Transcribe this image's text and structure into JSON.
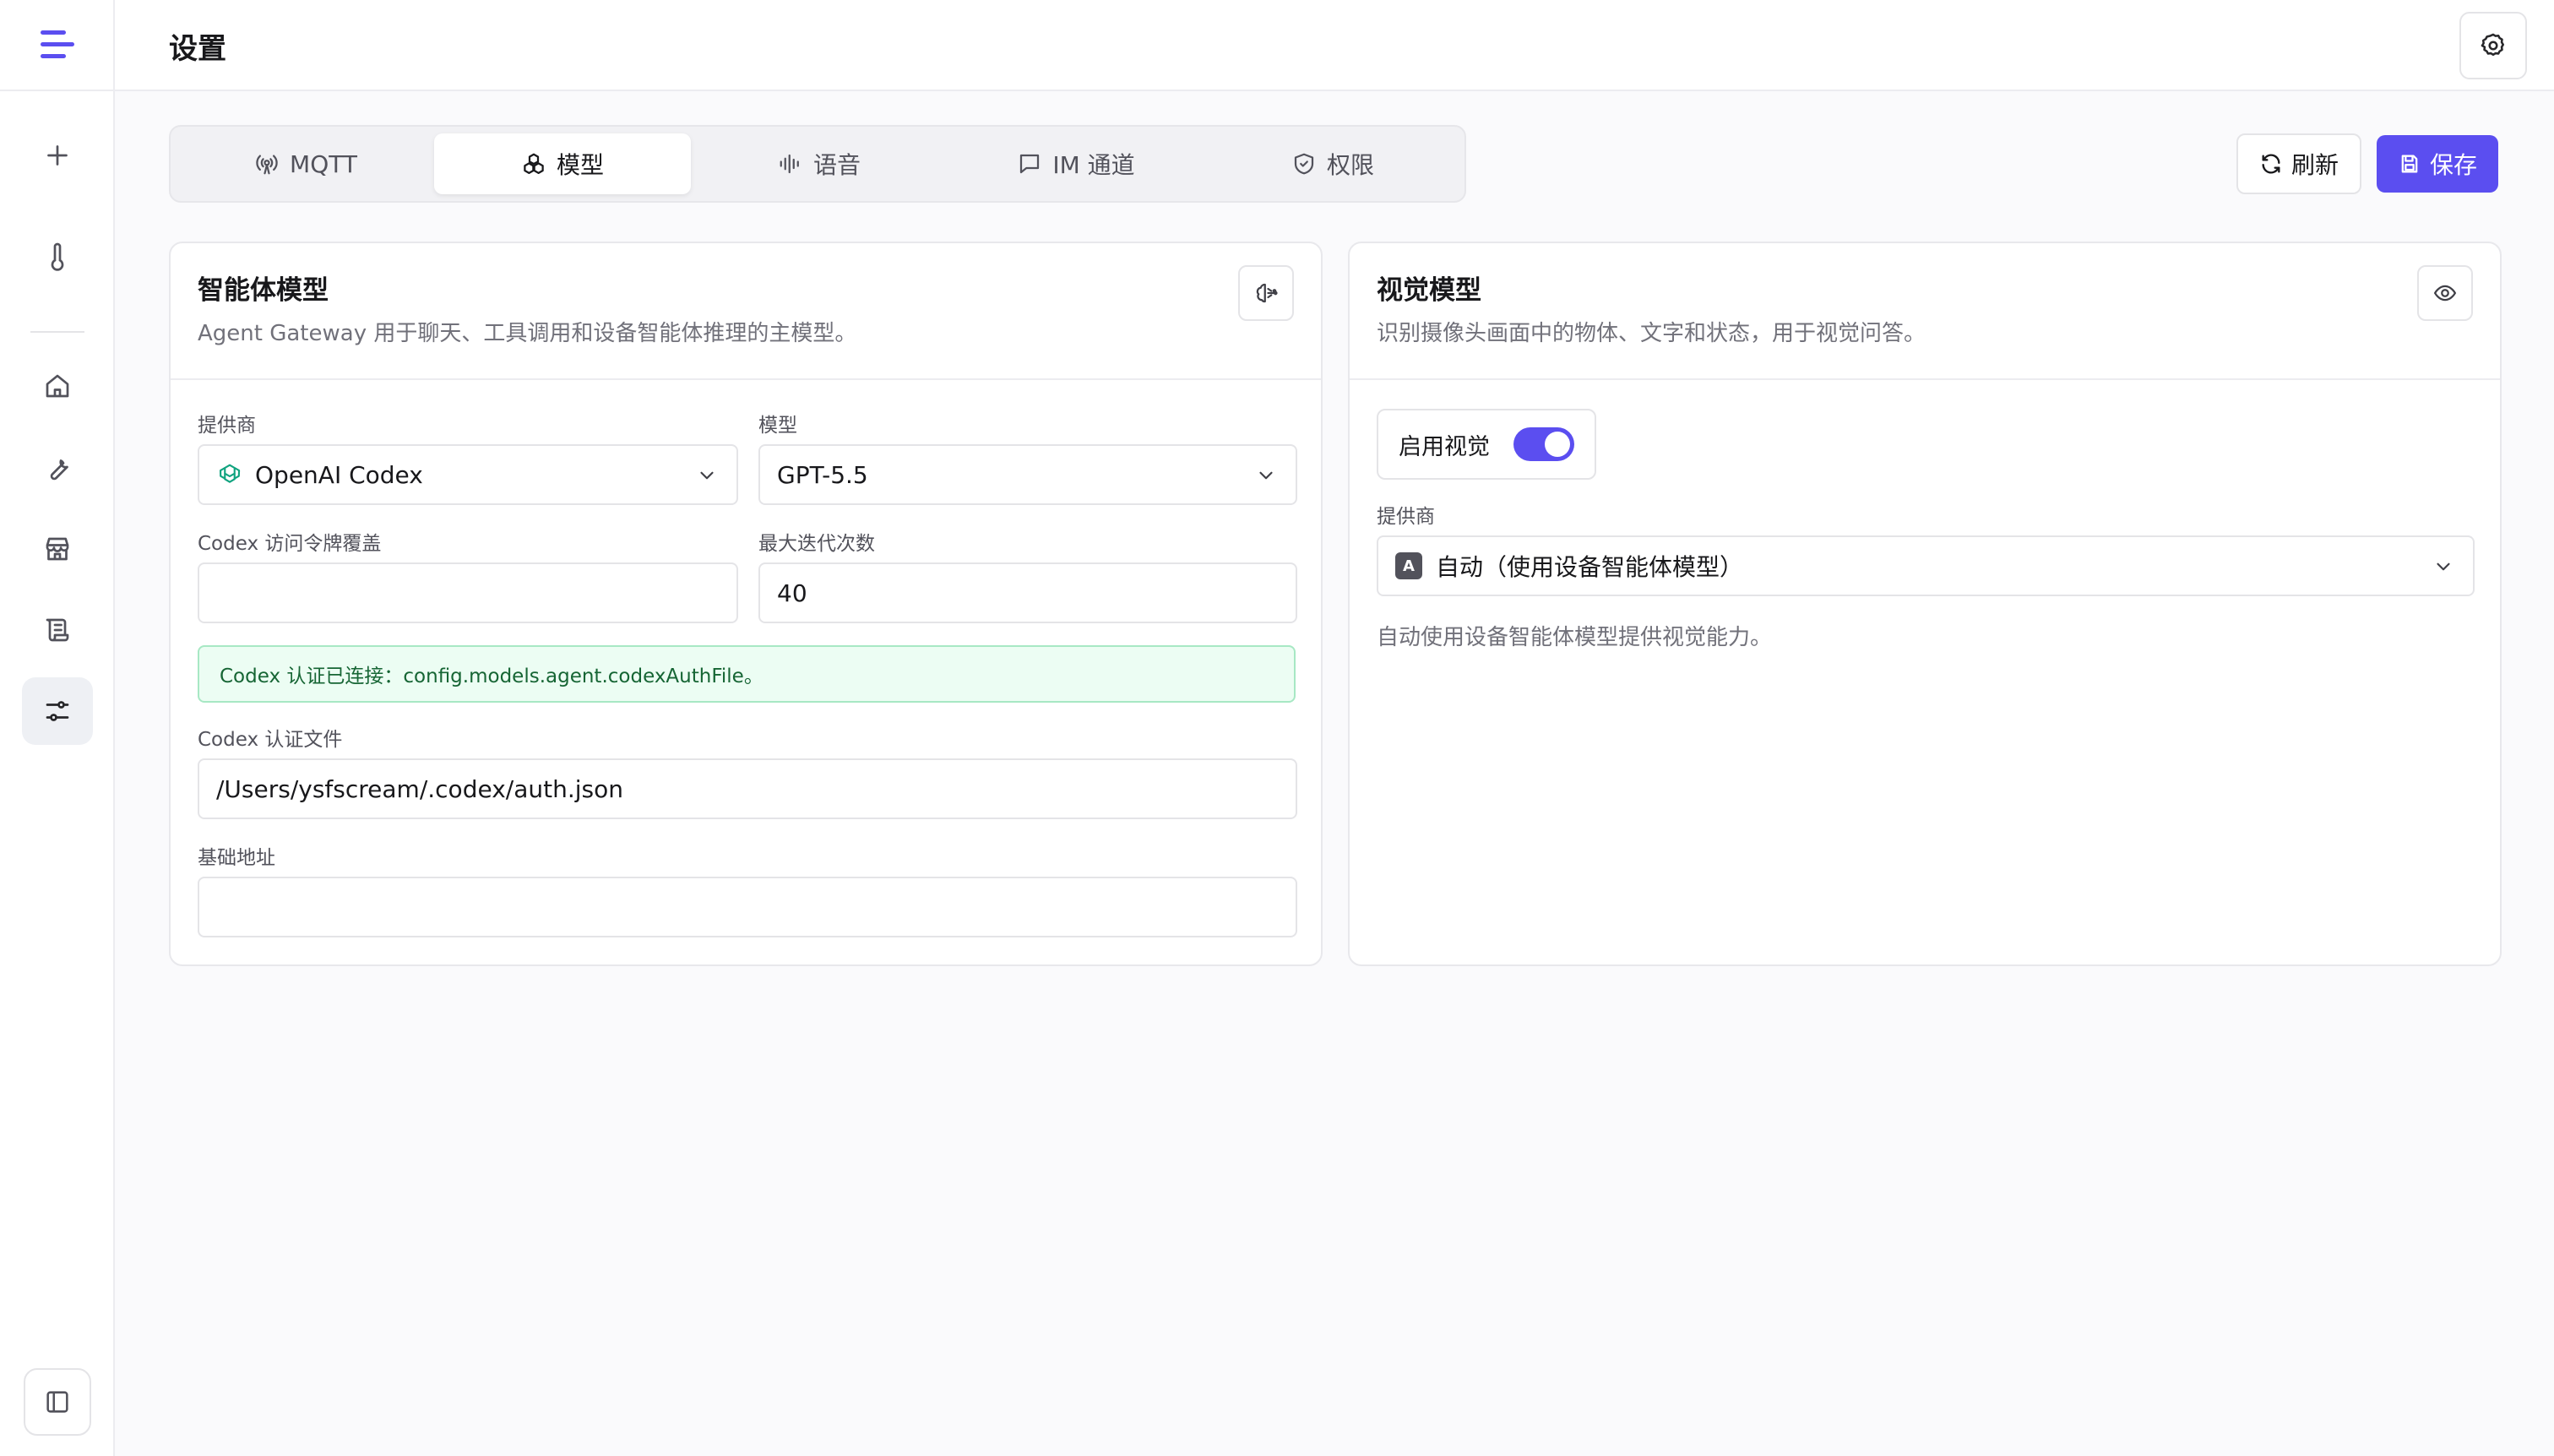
{
  "header": {
    "title": "设置"
  },
  "tabs": [
    {
      "label": "MQTT",
      "icon": "broadcast-icon",
      "active": false
    },
    {
      "label": "模型",
      "icon": "model-icon",
      "active": true
    },
    {
      "label": "语音",
      "icon": "waveform-icon",
      "active": false
    },
    {
      "label": "IM 通道",
      "icon": "chat-icon",
      "active": false
    },
    {
      "label": "权限",
      "icon": "shield-icon",
      "active": false
    }
  ],
  "actions": {
    "refresh_label": "刷新",
    "save_label": "保存"
  },
  "agent_model": {
    "title": "智能体模型",
    "description": "Agent Gateway 用于聊天、工具调用和设备智能体推理的主模型。",
    "provider_label": "提供商",
    "provider_value": "OpenAI Codex",
    "model_label": "模型",
    "model_value": "GPT-5.5",
    "token_label": "Codex 访问令牌覆盖",
    "token_value": "",
    "iterations_label": "最大迭代次数",
    "iterations_value": "40",
    "notice": "Codex 认证已连接：config.models.agent.codexAuthFile。",
    "auth_file_label": "Codex 认证文件",
    "auth_file_value": "/Users/ysfscream/.codex/auth.json",
    "base_url_label": "基础地址",
    "base_url_value": ""
  },
  "vision_model": {
    "title": "视觉模型",
    "description": "识别摄像头画面中的物体、文字和状态，用于视觉问答。",
    "enable_label": "启用视觉",
    "enabled": true,
    "provider_label": "提供商",
    "provider_badge": "A",
    "provider_value": "自动（使用设备智能体模型）",
    "hint": "自动使用设备智能体模型提供视觉能力。"
  },
  "colors": {
    "accent": "#5b4ef0",
    "success_bg": "#ecfdf3",
    "success_text": "#166534"
  }
}
